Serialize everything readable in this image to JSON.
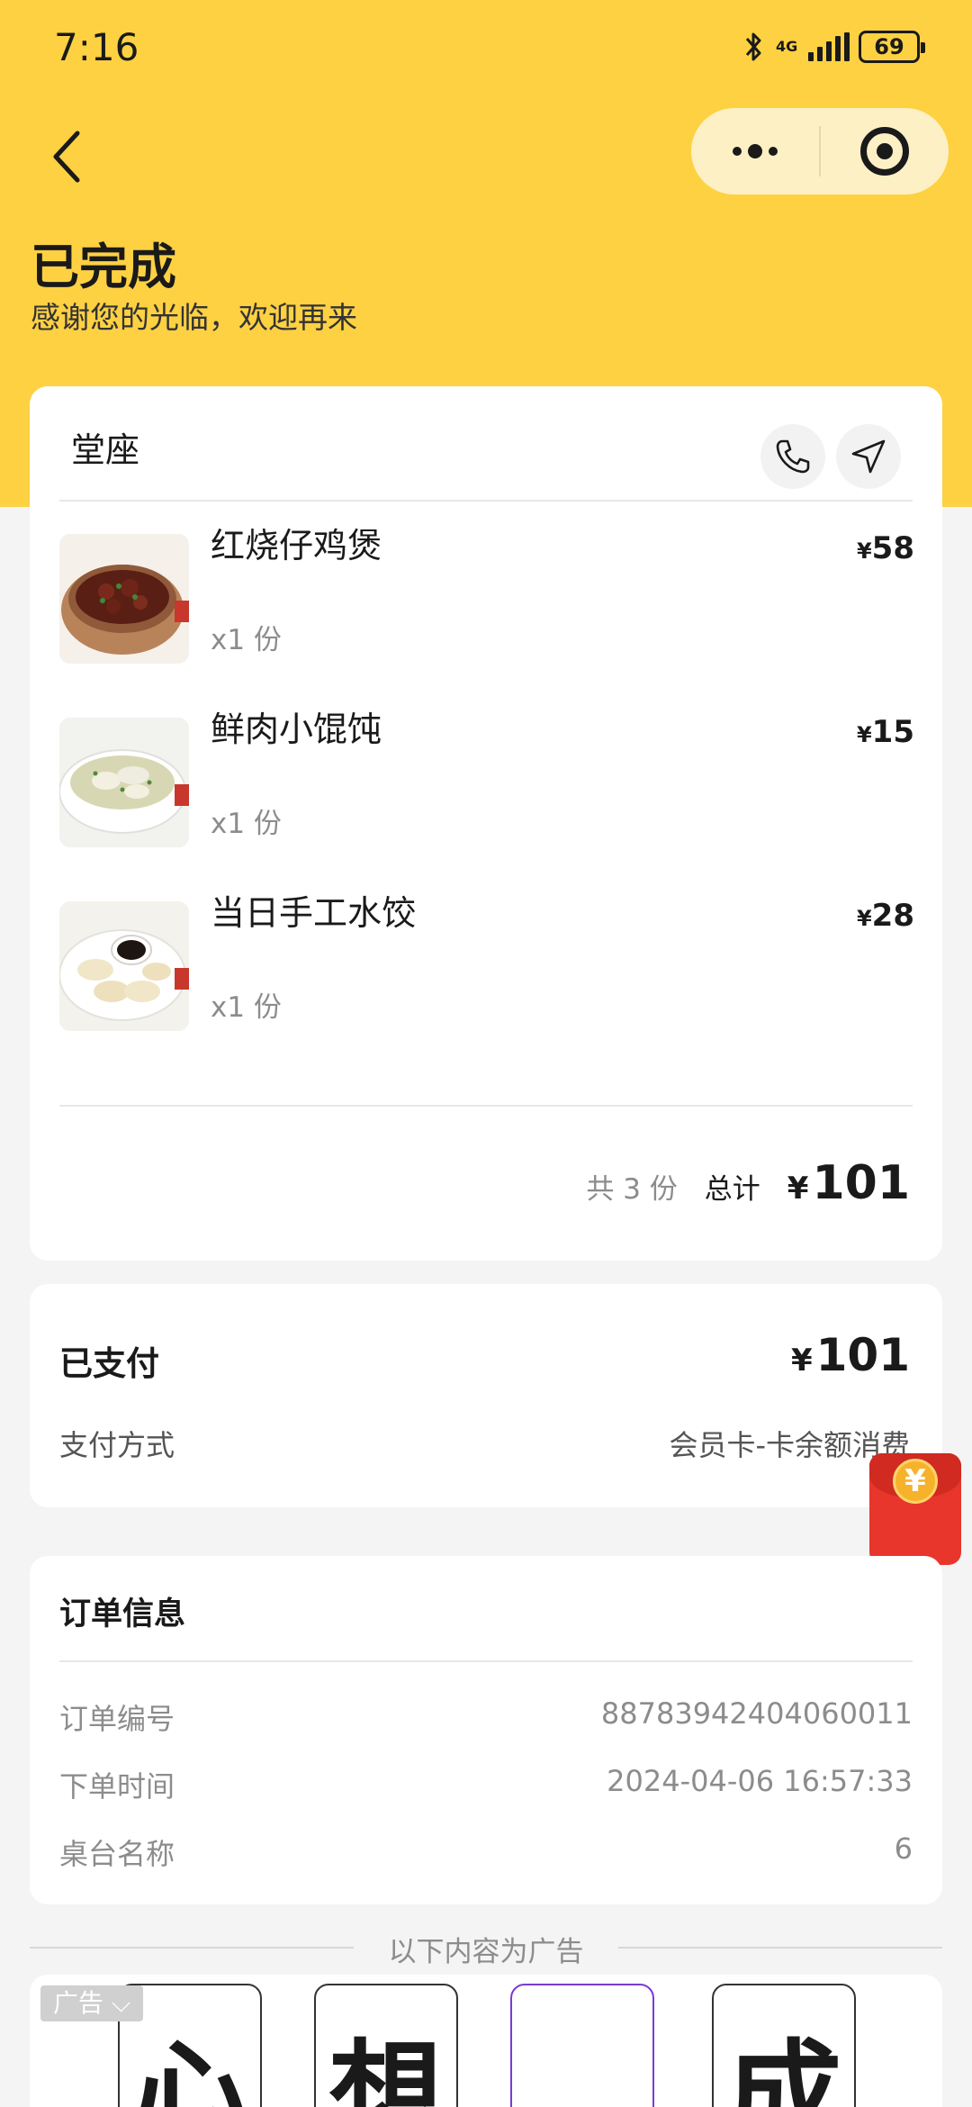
{
  "status_bar": {
    "time": "7:16",
    "network": "4G",
    "battery": "69"
  },
  "header": {
    "title": "已完成",
    "subtitle": "感谢您的光临，欢迎再来"
  },
  "order": {
    "dine_type": "堂座",
    "items": [
      {
        "name": "红烧仔鸡煲",
        "qty": "x1 份",
        "currency": "¥",
        "price": "58"
      },
      {
        "name": "鲜肉小馄饨",
        "qty": "x1 份",
        "currency": "¥",
        "price": "15"
      },
      {
        "name": "当日手工水饺",
        "qty": "x1 份",
        "currency": "¥",
        "price": "28"
      }
    ],
    "summary": {
      "count": "共 3 份",
      "total_label": "总计",
      "currency": "¥",
      "total": "101"
    }
  },
  "payment": {
    "status": "已支付",
    "currency": "¥",
    "amount": "101",
    "method_label": "支付方式",
    "method_value": "会员卡-卡余额消费"
  },
  "order_info": {
    "title": "订单信息",
    "rows": [
      {
        "label": "订单编号",
        "value": "88783942404060011"
      },
      {
        "label": "下单时间",
        "value": "2024-04-06 16:57:33"
      },
      {
        "label": "桌台名称",
        "value": "6"
      }
    ]
  },
  "ad": {
    "divider_text": "以下内容为广告",
    "tag": "广告 ⌵",
    "tiles": [
      "心",
      "想",
      "",
      "成"
    ]
  },
  "floating": {
    "redpack_symbol": "¥"
  },
  "colors": {
    "header_yellow": "#fed143",
    "capsule_bg": "#fdf0c4",
    "redpack": "#e8362c"
  }
}
